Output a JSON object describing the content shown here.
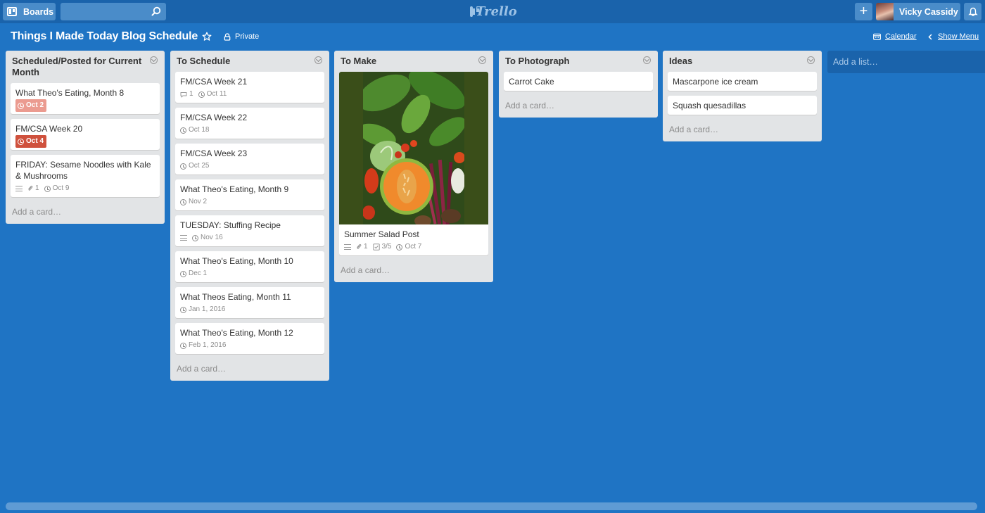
{
  "header": {
    "boards_label": "Boards",
    "search_value": "",
    "logo_text": "Trello",
    "add_label": "+",
    "user_name": "Vicky Cassidy"
  },
  "board": {
    "title": "Things I Made Today Blog Schedule",
    "visibility": "Private",
    "calendar_label": "Calendar",
    "show_menu_label": "Show Menu",
    "add_list_label": "Add a list…"
  },
  "lists": [
    {
      "title": "Scheduled/Posted for Current Month",
      "add_card": "Add a card…",
      "cards": [
        {
          "title": "What Theo's Eating, Month 8",
          "due": "Oct 2",
          "due_style": "pink"
        },
        {
          "title": "FM/CSA Week 20",
          "due": "Oct 4",
          "due_style": "red"
        },
        {
          "title": "FRIDAY: Sesame Noodles with Kale & Mushrooms",
          "has_description": true,
          "attachments": "1",
          "due": "Oct 9",
          "due_style": "plain"
        }
      ]
    },
    {
      "title": "To Schedule",
      "add_card": "Add a card…",
      "cards": [
        {
          "title": "FM/CSA Week 21",
          "comments": "1",
          "due": "Oct 11"
        },
        {
          "title": "FM/CSA Week 22",
          "due": "Oct 18"
        },
        {
          "title": "FM/CSA Week 23",
          "due": "Oct 25"
        },
        {
          "title": "What Theo's Eating, Month 9",
          "due": "Nov 2"
        },
        {
          "title": "TUESDAY: Stuffing Recipe",
          "has_description": true,
          "due": "Nov 16"
        },
        {
          "title": "What Theo's Eating, Month 10",
          "due": "Dec 1"
        },
        {
          "title": "What Theos Eating, Month 11",
          "due": "Jan 1, 2016"
        },
        {
          "title": "What Theo's Eating, Month 12",
          "due": "Feb 1, 2016"
        }
      ]
    },
    {
      "title": "To Make",
      "add_card": "Add a card…",
      "cards": [
        {
          "title": "Summer Salad Post",
          "has_cover": true,
          "has_description": true,
          "attachments": "1",
          "checklist": "3/5",
          "due": "Oct 7"
        }
      ]
    },
    {
      "title": "To Photograph",
      "add_card": "Add a card…",
      "cards": [
        {
          "title": "Carrot Cake"
        }
      ]
    },
    {
      "title": "Ideas",
      "add_card": "Add a card…",
      "cards": [
        {
          "title": "Mascarpone ice cream"
        },
        {
          "title": "Squash quesadillas"
        }
      ]
    }
  ],
  "colors": {
    "board_background": "#1f74c4",
    "header_background": "#1a63ab",
    "list_background": "#e2e4e6",
    "due_overdue": "#cf513d",
    "due_past": "#eb9b90"
  }
}
